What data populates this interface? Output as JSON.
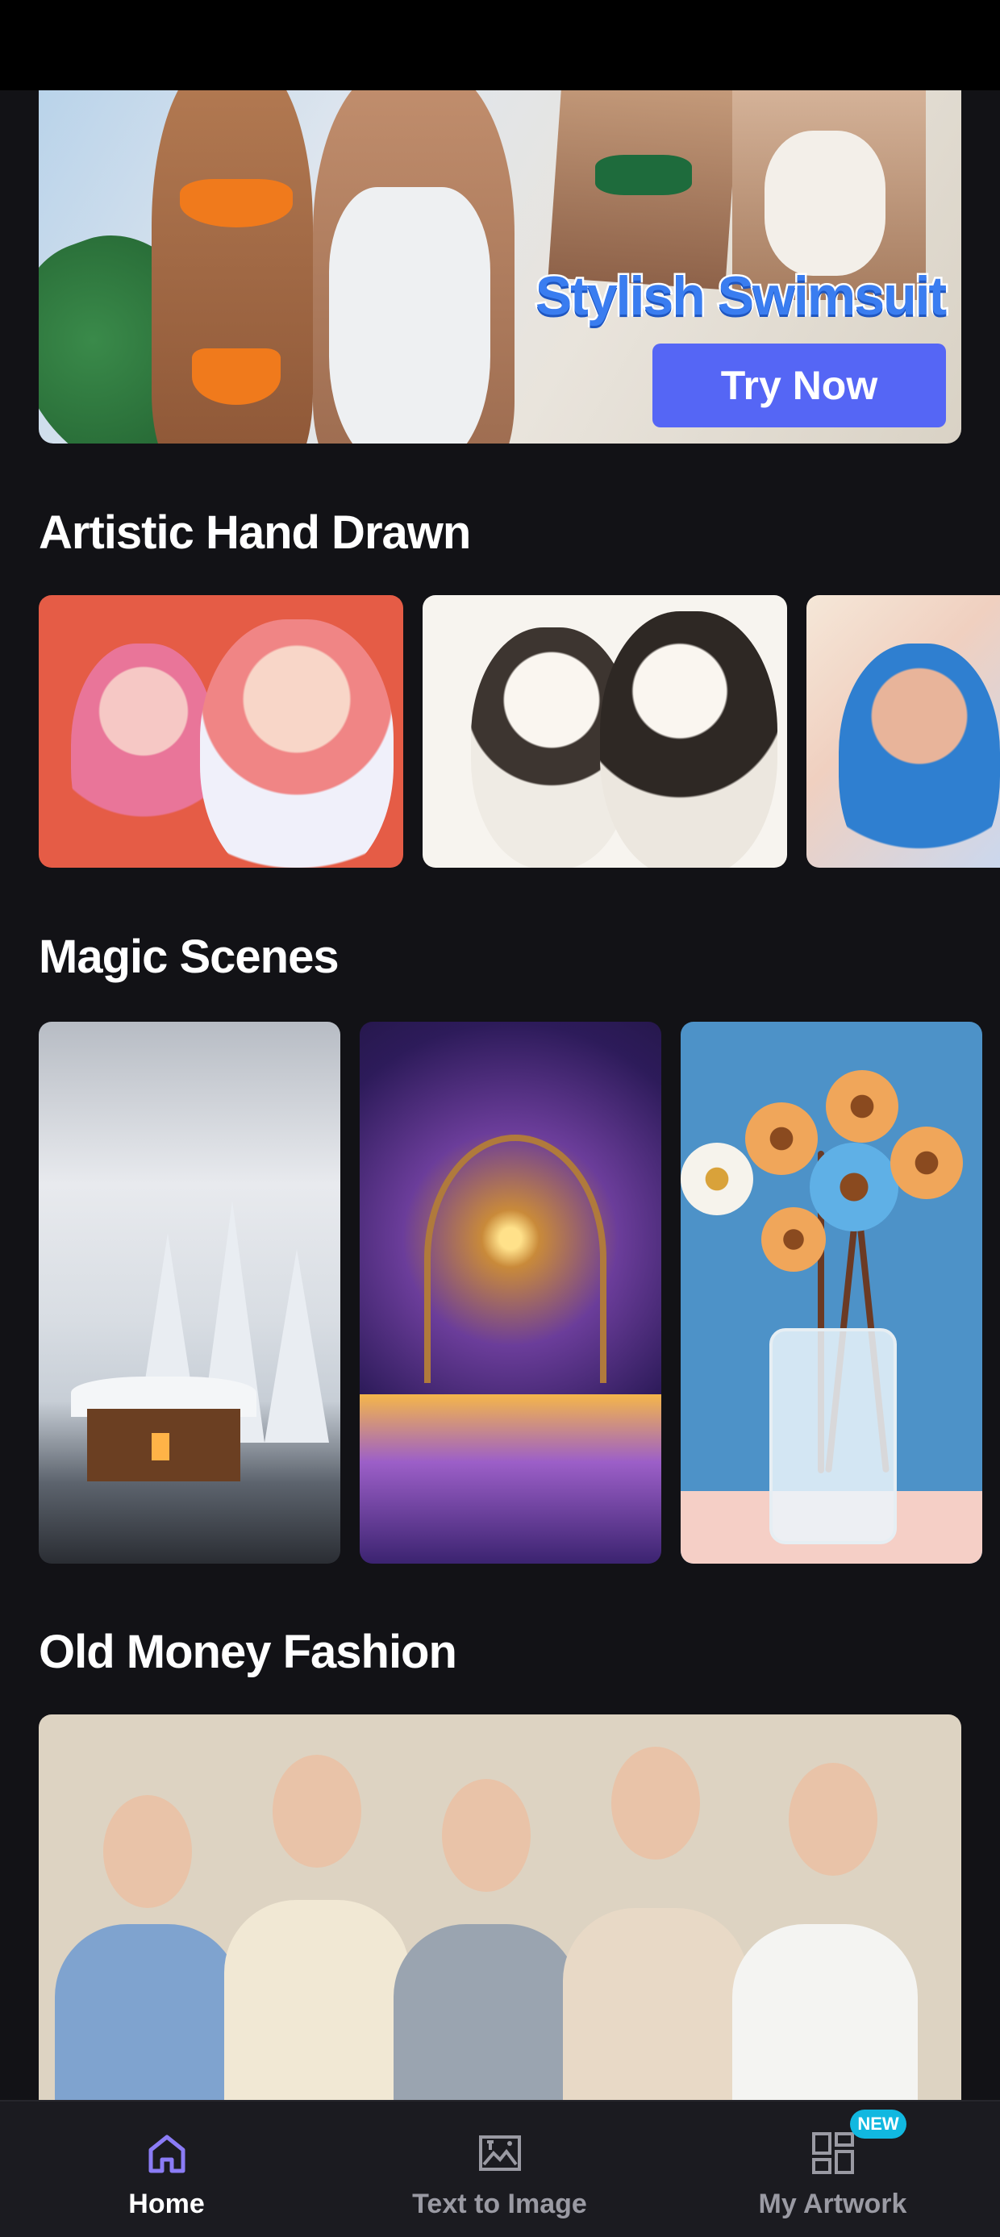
{
  "banner": {
    "title": "Stylish Swimsuit",
    "cta": "Try Now"
  },
  "sections": {
    "artistic": {
      "title": "Artistic Hand Drawn"
    },
    "magic": {
      "title": "Magic Scenes"
    },
    "old_money": {
      "title": "Old Money Fashion"
    }
  },
  "nav": {
    "items": [
      {
        "label": "Home",
        "icon": "home-icon",
        "active": true
      },
      {
        "label": "Text to Image",
        "icon": "image-icon",
        "active": false
      },
      {
        "label": "My Artwork",
        "icon": "grid-icon",
        "active": false,
        "badge": "NEW"
      }
    ],
    "active_color": "#8b7cf6",
    "inactive_color": "#9a9aa3"
  }
}
